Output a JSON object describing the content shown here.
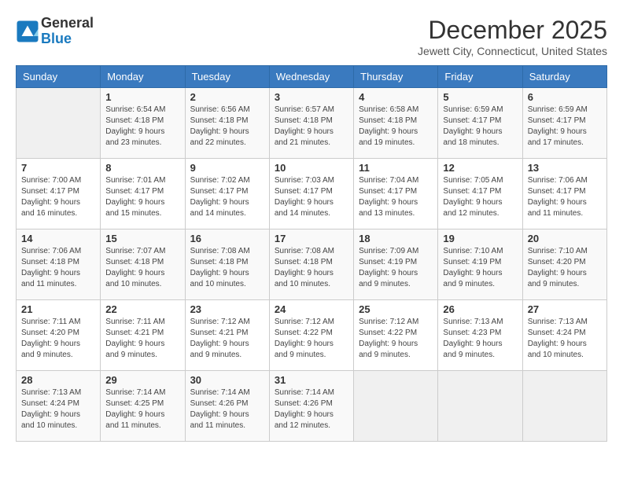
{
  "logo": {
    "general": "General",
    "blue": "Blue"
  },
  "title": "December 2025",
  "location": "Jewett City, Connecticut, United States",
  "headers": [
    "Sunday",
    "Monday",
    "Tuesday",
    "Wednesday",
    "Thursday",
    "Friday",
    "Saturday"
  ],
  "weeks": [
    [
      {
        "day": "",
        "sunrise": "",
        "sunset": "",
        "daylight": "",
        "empty": true
      },
      {
        "day": "1",
        "sunrise": "Sunrise: 6:54 AM",
        "sunset": "Sunset: 4:18 PM",
        "daylight": "Daylight: 9 hours and 23 minutes."
      },
      {
        "day": "2",
        "sunrise": "Sunrise: 6:56 AM",
        "sunset": "Sunset: 4:18 PM",
        "daylight": "Daylight: 9 hours and 22 minutes."
      },
      {
        "day": "3",
        "sunrise": "Sunrise: 6:57 AM",
        "sunset": "Sunset: 4:18 PM",
        "daylight": "Daylight: 9 hours and 21 minutes."
      },
      {
        "day": "4",
        "sunrise": "Sunrise: 6:58 AM",
        "sunset": "Sunset: 4:18 PM",
        "daylight": "Daylight: 9 hours and 19 minutes."
      },
      {
        "day": "5",
        "sunrise": "Sunrise: 6:59 AM",
        "sunset": "Sunset: 4:17 PM",
        "daylight": "Daylight: 9 hours and 18 minutes."
      },
      {
        "day": "6",
        "sunrise": "Sunrise: 6:59 AM",
        "sunset": "Sunset: 4:17 PM",
        "daylight": "Daylight: 9 hours and 17 minutes."
      }
    ],
    [
      {
        "day": "7",
        "sunrise": "Sunrise: 7:00 AM",
        "sunset": "Sunset: 4:17 PM",
        "daylight": "Daylight: 9 hours and 16 minutes."
      },
      {
        "day": "8",
        "sunrise": "Sunrise: 7:01 AM",
        "sunset": "Sunset: 4:17 PM",
        "daylight": "Daylight: 9 hours and 15 minutes."
      },
      {
        "day": "9",
        "sunrise": "Sunrise: 7:02 AM",
        "sunset": "Sunset: 4:17 PM",
        "daylight": "Daylight: 9 hours and 14 minutes."
      },
      {
        "day": "10",
        "sunrise": "Sunrise: 7:03 AM",
        "sunset": "Sunset: 4:17 PM",
        "daylight": "Daylight: 9 hours and 14 minutes."
      },
      {
        "day": "11",
        "sunrise": "Sunrise: 7:04 AM",
        "sunset": "Sunset: 4:17 PM",
        "daylight": "Daylight: 9 hours and 13 minutes."
      },
      {
        "day": "12",
        "sunrise": "Sunrise: 7:05 AM",
        "sunset": "Sunset: 4:17 PM",
        "daylight": "Daylight: 9 hours and 12 minutes."
      },
      {
        "day": "13",
        "sunrise": "Sunrise: 7:06 AM",
        "sunset": "Sunset: 4:17 PM",
        "daylight": "Daylight: 9 hours and 11 minutes."
      }
    ],
    [
      {
        "day": "14",
        "sunrise": "Sunrise: 7:06 AM",
        "sunset": "Sunset: 4:18 PM",
        "daylight": "Daylight: 9 hours and 11 minutes."
      },
      {
        "day": "15",
        "sunrise": "Sunrise: 7:07 AM",
        "sunset": "Sunset: 4:18 PM",
        "daylight": "Daylight: 9 hours and 10 minutes."
      },
      {
        "day": "16",
        "sunrise": "Sunrise: 7:08 AM",
        "sunset": "Sunset: 4:18 PM",
        "daylight": "Daylight: 9 hours and 10 minutes."
      },
      {
        "day": "17",
        "sunrise": "Sunrise: 7:08 AM",
        "sunset": "Sunset: 4:18 PM",
        "daylight": "Daylight: 9 hours and 10 minutes."
      },
      {
        "day": "18",
        "sunrise": "Sunrise: 7:09 AM",
        "sunset": "Sunset: 4:19 PM",
        "daylight": "Daylight: 9 hours and 9 minutes."
      },
      {
        "day": "19",
        "sunrise": "Sunrise: 7:10 AM",
        "sunset": "Sunset: 4:19 PM",
        "daylight": "Daylight: 9 hours and 9 minutes."
      },
      {
        "day": "20",
        "sunrise": "Sunrise: 7:10 AM",
        "sunset": "Sunset: 4:20 PM",
        "daylight": "Daylight: 9 hours and 9 minutes."
      }
    ],
    [
      {
        "day": "21",
        "sunrise": "Sunrise: 7:11 AM",
        "sunset": "Sunset: 4:20 PM",
        "daylight": "Daylight: 9 hours and 9 minutes."
      },
      {
        "day": "22",
        "sunrise": "Sunrise: 7:11 AM",
        "sunset": "Sunset: 4:21 PM",
        "daylight": "Daylight: 9 hours and 9 minutes."
      },
      {
        "day": "23",
        "sunrise": "Sunrise: 7:12 AM",
        "sunset": "Sunset: 4:21 PM",
        "daylight": "Daylight: 9 hours and 9 minutes."
      },
      {
        "day": "24",
        "sunrise": "Sunrise: 7:12 AM",
        "sunset": "Sunset: 4:22 PM",
        "daylight": "Daylight: 9 hours and 9 minutes."
      },
      {
        "day": "25",
        "sunrise": "Sunrise: 7:12 AM",
        "sunset": "Sunset: 4:22 PM",
        "daylight": "Daylight: 9 hours and 9 minutes."
      },
      {
        "day": "26",
        "sunrise": "Sunrise: 7:13 AM",
        "sunset": "Sunset: 4:23 PM",
        "daylight": "Daylight: 9 hours and 9 minutes."
      },
      {
        "day": "27",
        "sunrise": "Sunrise: 7:13 AM",
        "sunset": "Sunset: 4:24 PM",
        "daylight": "Daylight: 9 hours and 10 minutes."
      }
    ],
    [
      {
        "day": "28",
        "sunrise": "Sunrise: 7:13 AM",
        "sunset": "Sunset: 4:24 PM",
        "daylight": "Daylight: 9 hours and 10 minutes."
      },
      {
        "day": "29",
        "sunrise": "Sunrise: 7:14 AM",
        "sunset": "Sunset: 4:25 PM",
        "daylight": "Daylight: 9 hours and 11 minutes."
      },
      {
        "day": "30",
        "sunrise": "Sunrise: 7:14 AM",
        "sunset": "Sunset: 4:26 PM",
        "daylight": "Daylight: 9 hours and 11 minutes."
      },
      {
        "day": "31",
        "sunrise": "Sunrise: 7:14 AM",
        "sunset": "Sunset: 4:26 PM",
        "daylight": "Daylight: 9 hours and 12 minutes."
      },
      {
        "day": "",
        "sunrise": "",
        "sunset": "",
        "daylight": "",
        "empty": true
      },
      {
        "day": "",
        "sunrise": "",
        "sunset": "",
        "daylight": "",
        "empty": true
      },
      {
        "day": "",
        "sunrise": "",
        "sunset": "",
        "daylight": "",
        "empty": true
      }
    ]
  ]
}
